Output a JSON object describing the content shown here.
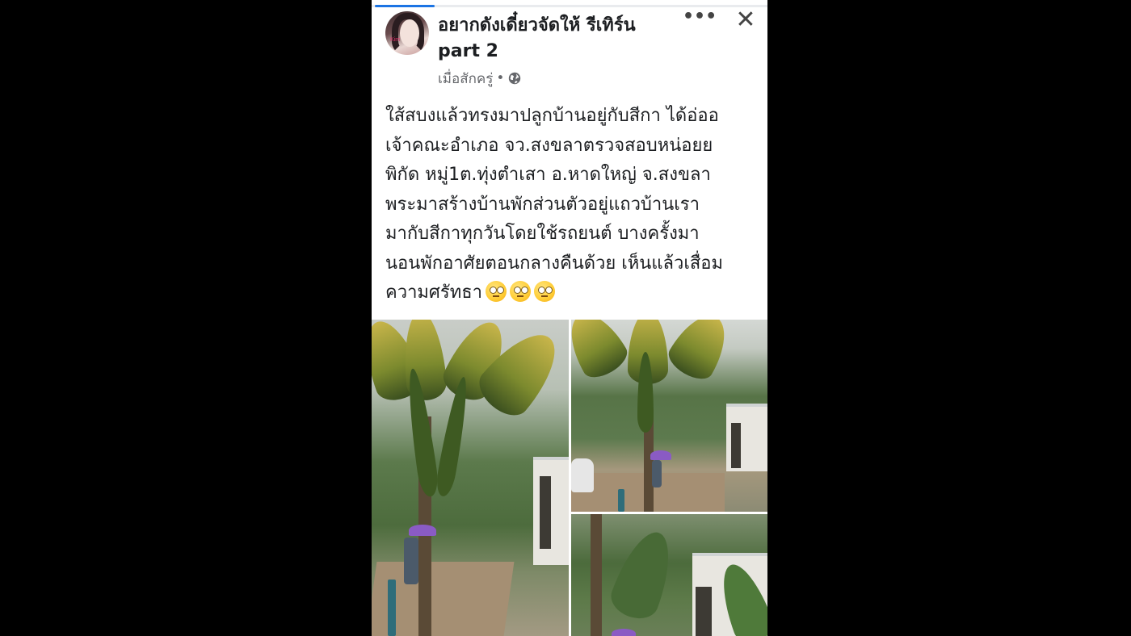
{
  "post": {
    "title_line1": "อยากดังเดี๋ยวจัดให้ รีเทิร์น",
    "title_line2": "part 2",
    "timestamp": "เมื่อสักครู่",
    "separator": "•",
    "privacy_icon": "globe-icon",
    "avatar_tag": "Kim",
    "more_label": "•••",
    "close_label": "✕",
    "body_lines": [
      "ใส้สบงแล้วทรงมาปลูกบ้านอยู่กับสีกา ได้อ่ออ",
      "เจ้าคณะอำเภอ จว.สงขลาตรวจสอบหน่อยย",
      "พิกัด หมู่1ต.ทุ่งตำเสา อ.หาดใหญ่ จ.สงขลา",
      "   พระมาสร้างบ้านพักส่วนตัวอยู่แถวบ้านเรา",
      "มากับสีกาทุกวันโดยใช้รถยนต์ บางครั้งมา",
      "นอนพักอาศัยตอนกลางคืนด้วย เห็นแล้วเสื่อม",
      "ความศรัทธา"
    ],
    "emoji_name": "face-with-rolling-eyes-emoji",
    "emoji_count": 3
  },
  "colors": {
    "background": "#000000",
    "card": "#ffffff",
    "text": "#1c1e21",
    "meta": "#65676b",
    "progress": "#1b74e4"
  }
}
